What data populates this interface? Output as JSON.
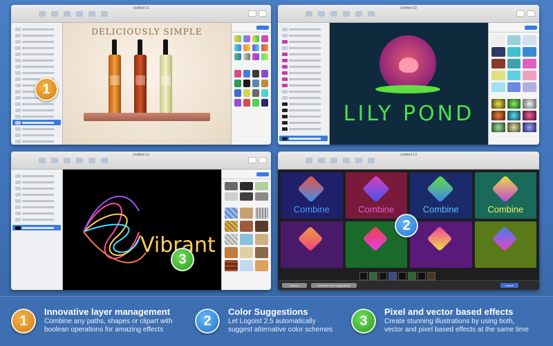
{
  "windows": {
    "w1": {
      "title": "Untitled 11"
    },
    "w2": {
      "title": "Untitled 10"
    },
    "w3": {
      "title": "Untitled 12"
    },
    "w4": {
      "title": "Untitled 13"
    }
  },
  "canvas1": {
    "heading": "DELICIOUSLY SIMPLE"
  },
  "canvas2": {
    "heading": "LILY POND"
  },
  "canvas3": {
    "heading": "Vibrant"
  },
  "canvas4": {
    "tile_label": "Combine",
    "options_button": "Options",
    "generate_button": "Generate new suggestions",
    "cancel_button": "Cancel"
  },
  "badges": {
    "one": "1",
    "two": "2",
    "three": "3"
  },
  "features": [
    {
      "number": "1",
      "title": "Innovative layer management",
      "line1": "Combine any paths, shapes or clipart with",
      "line2": "boolean operations for amazing effects",
      "color": "#e59a24"
    },
    {
      "number": "2",
      "title": "Color Suggestions",
      "line1": "Let Logoist 2.5 automatically",
      "line2": "suggest alternative color schemes",
      "color": "#2a87e0"
    },
    {
      "number": "3",
      "title": "Pixel and vector based effects",
      "line1": "Create stunning illustrations by using both,",
      "line2": "vector and pixel based effects at the same time",
      "color": "#3fb52c"
    }
  ]
}
